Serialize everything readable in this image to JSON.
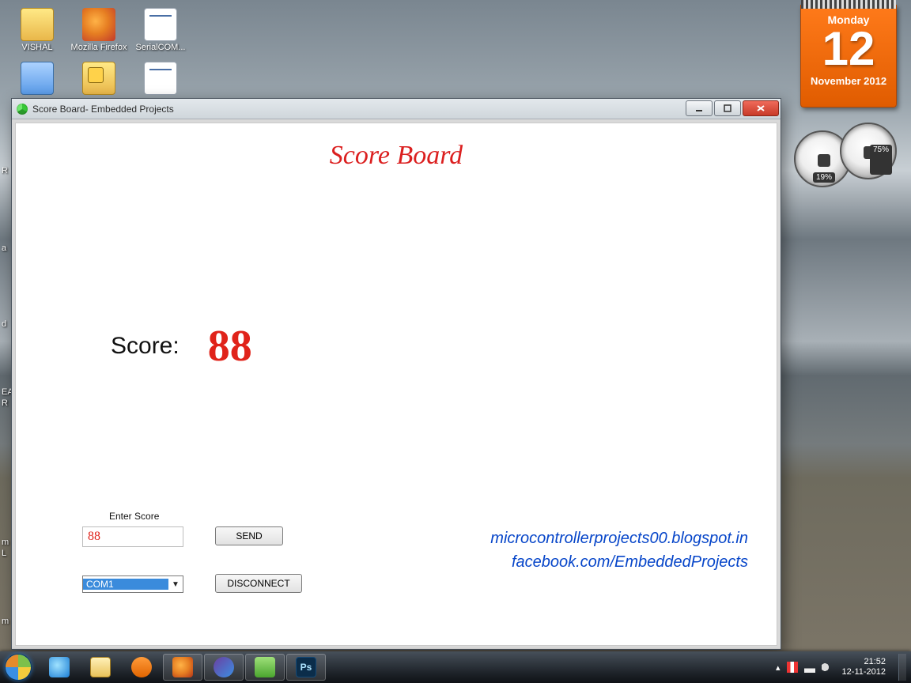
{
  "desktop_icons": {
    "vishal": "VISHAL",
    "firefox": "Mozilla Firefox",
    "serialcom": "SerialCOM...",
    "monitor": "",
    "tools": "",
    "doc2": ""
  },
  "edge_letters": {
    "r1": "R",
    "a1": "a",
    "d1": "d",
    "ea": "EA",
    "r2": "R",
    "m1": "m",
    "l1": "L",
    "m2": "m"
  },
  "calendar": {
    "weekday": "Monday",
    "day": "12",
    "month_year": "November 2012"
  },
  "meters": {
    "left_pct": "19%",
    "right_pct": "75%"
  },
  "window": {
    "title": "Score Board- Embedded Projects",
    "heading": "Score Board",
    "score_label": "Score:",
    "score_value": "88",
    "enter_label": "Enter Score",
    "input_value": "88",
    "send_label": "SEND",
    "com_value": "COM1",
    "disconnect_label": "DISCONNECT",
    "credits_blog": "microcontrollerprojects00.blogspot.in",
    "credits_fb": "facebook.com/EmbeddedProjects"
  },
  "taskbar": {
    "ps_label": "Ps"
  },
  "tray": {
    "time": "21:52",
    "date": "12-11-2012"
  }
}
